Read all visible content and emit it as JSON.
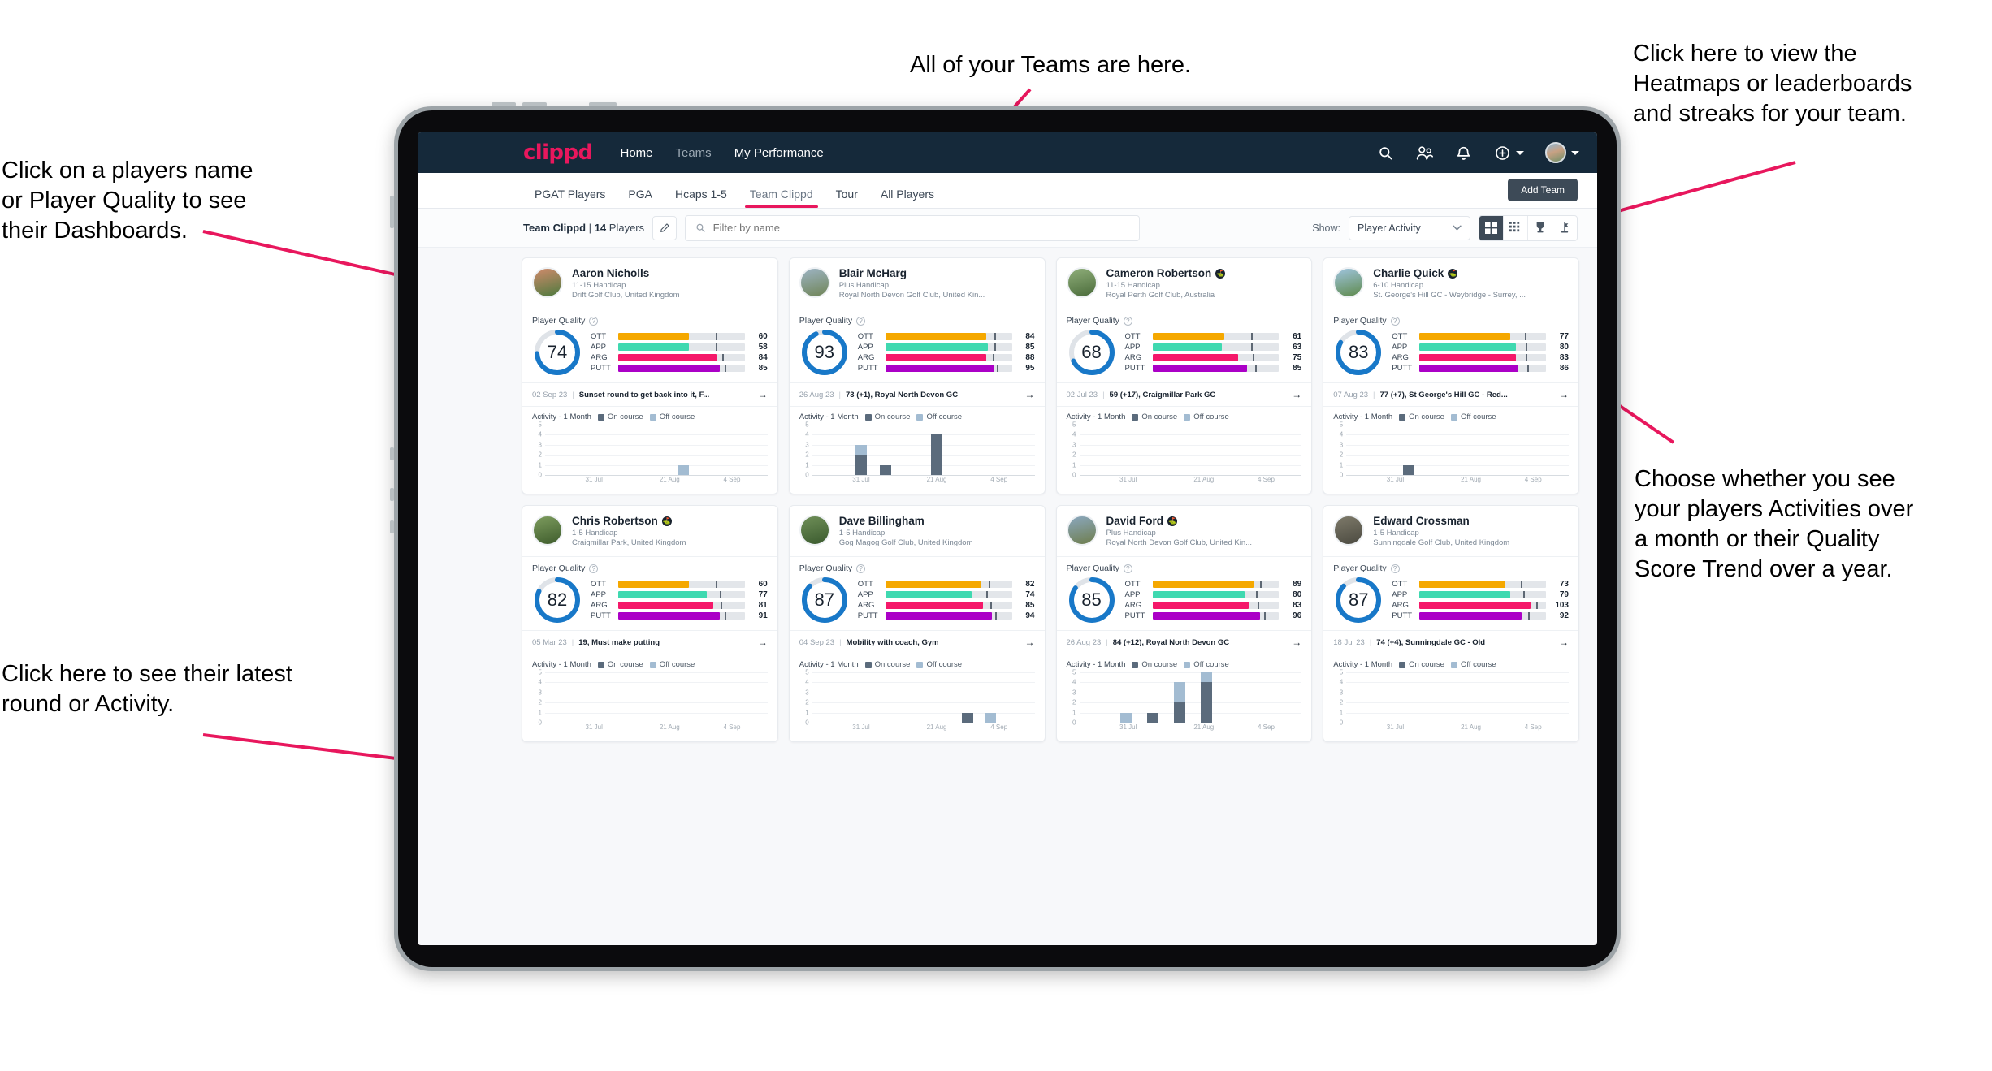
{
  "annotations": [
    {
      "id": "teams",
      "text": "All of your Teams are here."
    },
    {
      "id": "heatmaps",
      "text": "Click here to view the\nHeatmaps or leaderboards\nand streaks for your team."
    },
    {
      "id": "players-name",
      "text": "Click on a players name\nor Player Quality to see\ntheir Dashboards."
    },
    {
      "id": "choose-view",
      "text": "Choose whether you see\nyour players Activities over\na month or their Quality\nScore Trend over a year."
    },
    {
      "id": "latest-round",
      "text": "Click here to see their latest\nround or Activity."
    }
  ],
  "app": {
    "brand": "clippd",
    "nav": [
      {
        "label": "Home",
        "active": true
      },
      {
        "label": "Teams",
        "active": false
      },
      {
        "label": "My Performance",
        "active": true
      }
    ],
    "nav_icons": [
      "search-icon",
      "people-icon",
      "bell-icon",
      "plus-circle-icon",
      "avatar"
    ],
    "tabs": [
      {
        "label": "PGAT Players",
        "active": false
      },
      {
        "label": "PGA",
        "active": false
      },
      {
        "label": "Hcaps 1-5",
        "active": false
      },
      {
        "label": "Team Clippd",
        "active": true
      },
      {
        "label": "Tour",
        "active": false
      },
      {
        "label": "All Players",
        "active": false
      }
    ],
    "add_team_label": "Add Team",
    "filter": {
      "team_name": "Team Clippd",
      "separator": "|",
      "player_count": "14",
      "players_word": "Players",
      "edit_icon": "pencil-icon",
      "search_placeholder": "Filter by name",
      "show_label": "Show:",
      "show_value": "Player Activity",
      "view_buttons": [
        "grid-large-icon",
        "grid-small-icon",
        "trophy-icon",
        "flag-icon"
      ],
      "active_view": 0
    }
  },
  "labels": {
    "player_quality": "Player Quality",
    "activity": "Activity - 1 Month",
    "legend_on": "On course",
    "legend_off": "Off course",
    "chart_y": [
      "5",
      "4",
      "3",
      "2",
      "1",
      "0"
    ],
    "chart_x": [
      "31 Jul",
      "21 Aug",
      "4 Sep"
    ]
  },
  "colors": {
    "accent": "#e8175d",
    "nav_bg": "#15293a",
    "ring": "#1878c8",
    "ott": "#f5a800",
    "app": "#3fd9b0",
    "arg": "#f5186a",
    "putt": "#ab00c7",
    "on_course": "#5b6b7c",
    "off_course": "#a3bcd2"
  },
  "chart_data": [
    {
      "type": "bar",
      "title": "Activity - 1 Month",
      "player": "Aaron Nicholls",
      "ylim": [
        0,
        5
      ],
      "xlabel": "",
      "ylabel": "",
      "grid": true,
      "legend": [
        "On course",
        "Off course"
      ],
      "x": [
        "31 Jul",
        "21 Aug",
        "4 Sep"
      ],
      "bars": [
        {
          "pos": 0.62,
          "on": 0,
          "off": 1
        }
      ]
    },
    {
      "type": "bar",
      "title": "Activity - 1 Month",
      "player": "Blair McHarg",
      "ylim": [
        0,
        5
      ],
      "grid": true,
      "legend": [
        "On course",
        "Off course"
      ],
      "x": [
        "31 Jul",
        "21 Aug",
        "4 Sep"
      ],
      "bars": [
        {
          "pos": 0.22,
          "on": 2,
          "off": 1
        },
        {
          "pos": 0.33,
          "on": 1,
          "off": 0
        },
        {
          "pos": 0.56,
          "on": 4,
          "off": 0
        }
      ]
    },
    {
      "type": "bar",
      "title": "Activity - 1 Month",
      "player": "Cameron Robertson",
      "ylim": [
        0,
        5
      ],
      "grid": true,
      "legend": [
        "On course",
        "Off course"
      ],
      "x": [
        "31 Jul",
        "21 Aug",
        "4 Sep"
      ],
      "bars": []
    },
    {
      "type": "bar",
      "title": "Activity - 1 Month",
      "player": "Charlie Quick",
      "ylim": [
        0,
        5
      ],
      "grid": true,
      "legend": [
        "On course",
        "Off course"
      ],
      "x": [
        "31 Jul",
        "21 Aug",
        "4 Sep"
      ],
      "bars": [
        {
          "pos": 0.28,
          "on": 1,
          "off": 0
        }
      ]
    },
    {
      "type": "bar",
      "title": "Activity - 1 Month",
      "player": "Chris Robertson",
      "ylim": [
        0,
        5
      ],
      "grid": true,
      "legend": [
        "On course",
        "Off course"
      ],
      "x": [
        "31 Jul",
        "21 Aug",
        "4 Sep"
      ],
      "bars": []
    },
    {
      "type": "bar",
      "title": "Activity - 1 Month",
      "player": "Dave Billingham",
      "ylim": [
        0,
        5
      ],
      "grid": true,
      "legend": [
        "On course",
        "Off course"
      ],
      "x": [
        "31 Jul",
        "21 Aug",
        "4 Sep"
      ],
      "bars": [
        {
          "pos": 0.7,
          "on": 1,
          "off": 0
        },
        {
          "pos": 0.8,
          "on": 0,
          "off": 1
        }
      ]
    },
    {
      "type": "bar",
      "title": "Activity - 1 Month",
      "player": "David Ford",
      "ylim": [
        0,
        5
      ],
      "grid": true,
      "legend": [
        "On course",
        "Off course"
      ],
      "x": [
        "31 Jul",
        "21 Aug",
        "4 Sep"
      ],
      "bars": [
        {
          "pos": 0.21,
          "on": 0,
          "off": 1
        },
        {
          "pos": 0.33,
          "on": 1,
          "off": 0
        },
        {
          "pos": 0.45,
          "on": 2,
          "off": 2
        },
        {
          "pos": 0.57,
          "on": 4,
          "off": 1
        }
      ]
    },
    {
      "type": "bar",
      "title": "Activity - 1 Month",
      "player": "Edward Crossman",
      "ylim": [
        0,
        5
      ],
      "grid": true,
      "legend": [
        "On course",
        "Off course"
      ],
      "x": [
        "31 Jul",
        "21 Aug",
        "4 Sep"
      ],
      "bars": []
    }
  ],
  "players": [
    {
      "name": "Aaron Nicholls",
      "verified": false,
      "handicap": "11-15 Handicap",
      "club": "Drift Golf Club, United Kingdom",
      "quality": 74,
      "metrics": [
        {
          "label": "OTT",
          "value": 60,
          "fill": 0.56,
          "tick": 0.77
        },
        {
          "label": "APP",
          "value": 58,
          "fill": 0.56,
          "tick": 0.77
        },
        {
          "label": "ARG",
          "value": 84,
          "fill": 0.78,
          "tick": 0.82
        },
        {
          "label": "PUTT",
          "value": 85,
          "fill": 0.8,
          "tick": 0.84
        }
      ],
      "round_date": "02 Sep 23",
      "round_text": "Sunset round to get back into it, F...",
      "avatar_from": "#cf8a6b",
      "avatar_to": "#4d7a3e"
    },
    {
      "name": "Blair McHarg",
      "verified": false,
      "handicap": "Plus Handicap",
      "club": "Royal North Devon Golf Club, United Kin...",
      "quality": 93,
      "metrics": [
        {
          "label": "OTT",
          "value": 84,
          "fill": 0.8,
          "tick": 0.86
        },
        {
          "label": "APP",
          "value": 85,
          "fill": 0.81,
          "tick": 0.86
        },
        {
          "label": "ARG",
          "value": 88,
          "fill": 0.8,
          "tick": 0.85
        },
        {
          "label": "PUTT",
          "value": 95,
          "fill": 0.86,
          "tick": 0.88
        }
      ],
      "round_date": "26 Aug 23",
      "round_text": "73 (+1), Royal North Devon GC",
      "avatar_from": "#9db4c4",
      "avatar_to": "#6f8456"
    },
    {
      "name": "Cameron Robertson",
      "verified": true,
      "handicap": "11-15 Handicap",
      "club": "Royal Perth Golf Club, Australia",
      "quality": 68,
      "metrics": [
        {
          "label": "OTT",
          "value": 61,
          "fill": 0.57,
          "tick": 0.78
        },
        {
          "label": "APP",
          "value": 63,
          "fill": 0.55,
          "tick": 0.78
        },
        {
          "label": "ARG",
          "value": 75,
          "fill": 0.68,
          "tick": 0.79
        },
        {
          "label": "PUTT",
          "value": 85,
          "fill": 0.75,
          "tick": 0.81
        }
      ],
      "round_date": "02 Jul 23",
      "round_text": "59 (+17), Craigmillar Park GC",
      "avatar_from": "#8fae7a",
      "avatar_to": "#4a6b3a"
    },
    {
      "name": "Charlie Quick",
      "verified": true,
      "handicap": "6-10 Handicap",
      "club": "St. George's Hill GC - Weybridge - Surrey, ...",
      "quality": 83,
      "metrics": [
        {
          "label": "OTT",
          "value": 77,
          "fill": 0.72,
          "tick": 0.83
        },
        {
          "label": "APP",
          "value": 80,
          "fill": 0.76,
          "tick": 0.84
        },
        {
          "label": "ARG",
          "value": 83,
          "fill": 0.76,
          "tick": 0.84
        },
        {
          "label": "PUTT",
          "value": 86,
          "fill": 0.78,
          "tick": 0.85
        }
      ],
      "round_date": "07 Aug 23",
      "round_text": "77 (+7), St George's Hill GC - Red...",
      "avatar_from": "#9fc4de",
      "avatar_to": "#5e8a4c"
    },
    {
      "name": "Chris Robertson",
      "verified": true,
      "handicap": "1-5 Handicap",
      "club": "Craigmillar Park, United Kingdom",
      "quality": 82,
      "metrics": [
        {
          "label": "OTT",
          "value": 60,
          "fill": 0.56,
          "tick": 0.77
        },
        {
          "label": "APP",
          "value": 77,
          "fill": 0.7,
          "tick": 0.8
        },
        {
          "label": "ARG",
          "value": 81,
          "fill": 0.75,
          "tick": 0.81
        },
        {
          "label": "PUTT",
          "value": 91,
          "fill": 0.8,
          "tick": 0.84
        }
      ],
      "round_date": "05 Mar 23",
      "round_text": "19, Must make putting",
      "avatar_from": "#7d9c5e",
      "avatar_to": "#3e5c2c"
    },
    {
      "name": "Dave Billingham",
      "verified": false,
      "handicap": "1-5 Handicap",
      "club": "Gog Magog Golf Club, United Kingdom",
      "quality": 87,
      "metrics": [
        {
          "label": "OTT",
          "value": 82,
          "fill": 0.76,
          "tick": 0.82
        },
        {
          "label": "APP",
          "value": 74,
          "fill": 0.68,
          "tick": 0.8
        },
        {
          "label": "ARG",
          "value": 85,
          "fill": 0.77,
          "tick": 0.83
        },
        {
          "label": "PUTT",
          "value": 94,
          "fill": 0.84,
          "tick": 0.87
        }
      ],
      "round_date": "04 Sep 23",
      "round_text": "Mobility with coach, Gym",
      "avatar_from": "#6f8f58",
      "avatar_to": "#3a5a2e"
    },
    {
      "name": "David Ford",
      "verified": true,
      "handicap": "Plus Handicap",
      "club": "Royal North Devon Golf Club, United Kin...",
      "quality": 85,
      "metrics": [
        {
          "label": "OTT",
          "value": 89,
          "fill": 0.8,
          "tick": 0.85
        },
        {
          "label": "APP",
          "value": 80,
          "fill": 0.73,
          "tick": 0.82
        },
        {
          "label": "ARG",
          "value": 83,
          "fill": 0.76,
          "tick": 0.83
        },
        {
          "label": "PUTT",
          "value": 96,
          "fill": 0.85,
          "tick": 0.88
        }
      ],
      "round_date": "26 Aug 23",
      "round_text": "84 (+12), Royal North Devon GC",
      "avatar_from": "#8ba8c0",
      "avatar_to": "#6e7d4c"
    },
    {
      "name": "Edward Crossman",
      "verified": false,
      "handicap": "1-5 Handicap",
      "club": "Sunningdale Golf Club, United Kingdom",
      "quality": 87,
      "metrics": [
        {
          "label": "OTT",
          "value": 73,
          "fill": 0.68,
          "tick": 0.8
        },
        {
          "label": "APP",
          "value": 79,
          "fill": 0.72,
          "tick": 0.82
        },
        {
          "label": "ARG",
          "value": 103,
          "fill": 0.88,
          "tick": 0.92
        },
        {
          "label": "PUTT",
          "value": 92,
          "fill": 0.81,
          "tick": 0.86
        }
      ],
      "round_date": "18 Jul 23",
      "round_text": "74 (+4), Sunningdale GC - Old",
      "avatar_from": "#7e7a6a",
      "avatar_to": "#4b4a40"
    }
  ]
}
